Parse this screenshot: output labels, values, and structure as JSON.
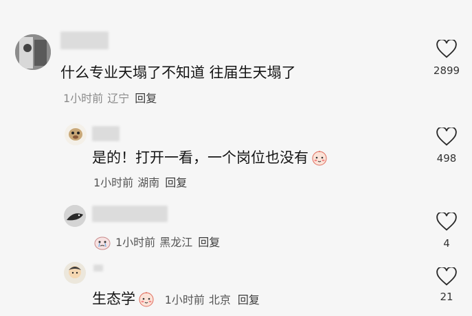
{
  "comments": [
    {
      "text": "什么专业天塌了不知道 往届生天塌了",
      "time": "1小时前",
      "location": "辽宁",
      "reply_label": "回复",
      "likes": "2899",
      "avatar_icon": "portrait-avatar",
      "is_reply": false
    },
    {
      "text": "是的！打开一看，一个岗位也没有",
      "emoji": "shy-face-emoji",
      "time": "1小时前",
      "location": "湖南",
      "reply_label": "回复",
      "likes": "498",
      "avatar_icon": "cartoon-dog-avatar",
      "is_reply": true
    },
    {
      "text": "",
      "sticker": "crying-sticker",
      "time": "1小时前",
      "location": "黑龙江",
      "reply_label": "回复",
      "likes": "4",
      "avatar_icon": "bird-avatar",
      "is_reply": true
    },
    {
      "text": "生态学",
      "emoji": "shy-face-emoji",
      "time": "1小时前",
      "location": "北京",
      "reply_label": "回复",
      "likes": "21",
      "avatar_icon": "cartoon-avatar",
      "is_reply": true
    }
  ],
  "colors": {
    "background": "#f6f6f6",
    "meta_text": "#8a8a8a",
    "reply_text": "#3a3a3a",
    "heart_stroke": "#2a2a2a"
  }
}
